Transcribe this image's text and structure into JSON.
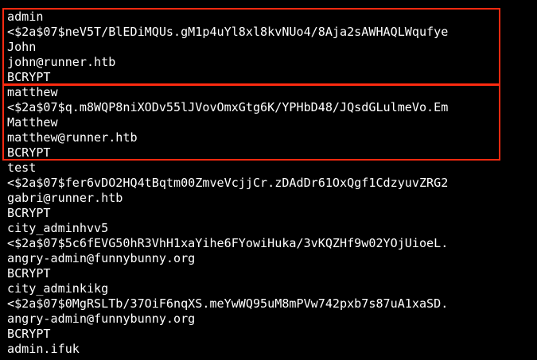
{
  "terminal": {
    "lines": [
      "admin",
      "<$2a$07$neV5T/BlEDiMQUs.gM1p4uYl8xl8kvNUo4/8Aja2sAWHAQLWqufye",
      "John",
      "john@runner.htb",
      "BCRYPT",
      "matthew",
      "<$2a$07$q.m8WQP8niXODv55lJVovOmxGtg6K/YPHbD48/JQsdGLulmeVo.Em",
      "Matthew",
      "matthew@runner.htb",
      "BCRYPT",
      "test",
      "<$2a$07$fer6vDO2HQ4tBqtm00ZmveVcjjCr.zDAdDr61OxQgf1CdzyuvZRG2",
      "gabri@runner.htb",
      "BCRYPT",
      "city_adminhvv5",
      "<$2a$07$5c6fEVG50hR3VhH1xaYihe6FYowiHuka/3vKQZHf9w02YOjUioeL.",
      "angry-admin@funnybunny.org",
      "BCRYPT",
      "city_adminkikg",
      "<$2a$07$0MgRSLTb/37OiF6nqXS.meYwWQ95uM8mPVw742pxb7s87uA1xaSD.",
      "angry-admin@funnybunny.org",
      "BCRYPT",
      "admin.ifuk"
    ]
  },
  "colors": {
    "background": "#000000",
    "text": "#ffffff",
    "highlight_border": "#ff2a10"
  }
}
